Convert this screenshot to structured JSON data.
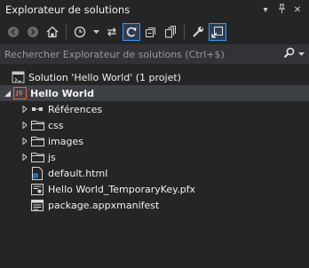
{
  "panel": {
    "title": "Explorateur de solutions",
    "pin_glyph": "⊥",
    "dropdown_glyph": "▾",
    "close_glyph": "✕"
  },
  "toolbar": {
    "buttons": [
      "back-icon",
      "forward-icon",
      "home-icon",
      "pending-changes-icon",
      "sync-icon",
      "refresh-icon",
      "collapse-all-icon",
      "show-all-files-icon",
      "properties-icon",
      "preview-selected-icon"
    ]
  },
  "search": {
    "placeholder": "Rechercher Explorateur de solutions (Ctrl+$)",
    "value": ""
  },
  "tree": {
    "solution": "Solution 'Hello World' (1 projet)",
    "project": "Hello World",
    "project_badge": "JS",
    "items": [
      {
        "label": "Références",
        "icon": "references-icon",
        "expandable": true
      },
      {
        "label": "css",
        "icon": "folder-icon",
        "expandable": true
      },
      {
        "label": "images",
        "icon": "folder-icon",
        "expandable": true
      },
      {
        "label": "js",
        "icon": "folder-icon",
        "expandable": true
      },
      {
        "label": "default.html",
        "icon": "html-file-icon",
        "expandable": false
      },
      {
        "label": "Hello World_TemporaryKey.pfx",
        "icon": "certificate-file-icon",
        "expandable": false
      },
      {
        "label": "package.appxmanifest",
        "icon": "manifest-file-icon",
        "expandable": false
      }
    ]
  },
  "colors": {
    "background": "#252526",
    "text": "#f1f1f1",
    "accent": "#3399ff",
    "selection": "#3f3f46"
  }
}
